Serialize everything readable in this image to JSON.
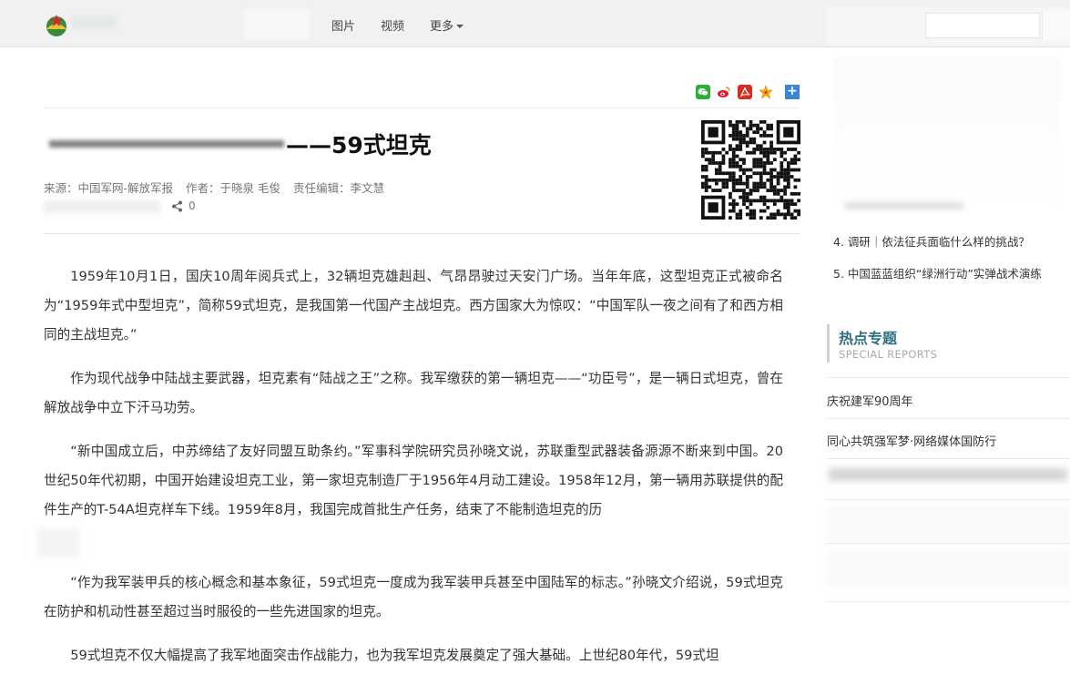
{
  "nav": {
    "items": [
      "图片",
      "视频",
      "更多"
    ]
  },
  "share": {
    "icons": [
      "wechat-icon",
      "weibo-icon",
      "pdf-icon",
      "favorite-icon",
      "more-share-icon"
    ]
  },
  "article": {
    "title_suffix": "——59式坦克",
    "meta": {
      "source": "来源：中国军网-解放军报",
      "author": "作者：于晓泉 毛俊",
      "editor": "责任编辑：李文慧"
    },
    "share_count": "0",
    "paragraphs": [
      "1959年10月1日，国庆10周年阅兵式上，32辆坦克雄赳赳、气昂昂驶过天安门广场。当年年底，这型坦克正式被命名为“1959年式中型坦克”，简称59式坦克，是我国第一代国产主战坦克。西方国家大为惊叹：“中国军队一夜之间有了和西方相同的主战坦克。”",
      "作为现代战争中陆战主要武器，坦克素有“陆战之王”之称。我军缴获的第一辆坦克——“功臣号”，是一辆日式坦克，曾在解放战争中立下汗马功劳。",
      "“新中国成立后，中苏缔结了友好同盟互助条约。”军事科学院研究员孙晓文说，苏联重型武器装备源源不断来到中国。20世纪50年代初期，中国开始建设坦克工业，第一家坦克制造厂于1956年4月动工建设。1958年12月，第一辆用苏联提供的配件生产的T-54A坦克样车下线。1959年8月，我国完成首批生产任务，结束了不能制造坦克的历",
      "“作为我军装甲兵的核心概念和基本象征，59式坦克一度成为我军装甲兵甚至中国陆军的标志。”孙晓文介绍说，59式坦克在防护和机动性甚至超过当时服役的一些先进国家的坦克。",
      "59式坦克不仅大幅提高了我军地面突击作战能力，也为我军坦克发展奠定了强大基础。上世纪80年代，59式坦"
    ]
  },
  "sidebar": {
    "ranking": [
      "4. 调研｜依法征兵面临什么样的挑战？",
      "5. 中国蓝蓝组织“绿洲行动”实弹战术演练"
    ],
    "special": {
      "title": "热点专题",
      "subtitle": "SPECIAL REPORTS",
      "items": [
        "庆祝建军90周年",
        "同心共筑强军梦·网络媒体国防行"
      ]
    }
  }
}
